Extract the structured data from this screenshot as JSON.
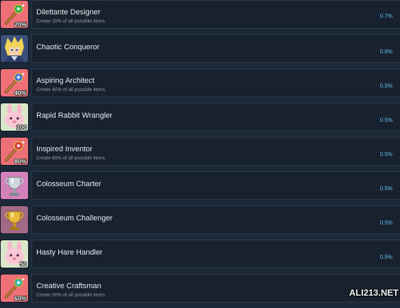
{
  "achievements": [
    {
      "title": "Dilettante Designer",
      "description": "Create 20% of all possible items.",
      "percent": "0.7%",
      "icon": "wand-icon",
      "badge": "20%"
    },
    {
      "title": "Chaotic Conqueror",
      "description": "",
      "percent": "0.6%",
      "icon": "hero-portrait-icon",
      "badge": ""
    },
    {
      "title": "Aspiring Architect",
      "description": "Create 40% of all possible items.",
      "percent": "0.5%",
      "icon": "wand-icon",
      "badge": "40%"
    },
    {
      "title": "Rapid Rabbit Wrangler",
      "description": "",
      "percent": "0.5%",
      "icon": "pink-rabbit-icon",
      "badge": "100"
    },
    {
      "title": "Inspired Inventor",
      "description": "Create 80% of all possible items.",
      "percent": "0.5%",
      "icon": "wand-icon",
      "badge": "80%"
    },
    {
      "title": "Colosseum Charter",
      "description": "",
      "percent": "0.5%",
      "icon": "silver-trophy-icon",
      "badge": ""
    },
    {
      "title": "Colosseum Challenger",
      "description": "",
      "percent": "0.5%",
      "icon": "gold-trophy-icon",
      "badge": ""
    },
    {
      "title": "Hasty Hare Handler",
      "description": "",
      "percent": "0.5%",
      "icon": "pink-rabbit-icon",
      "badge": "50"
    },
    {
      "title": "Creative Craftsman",
      "description": "Create 60% of all possible items.",
      "percent": "",
      "icon": "wand-icon",
      "badge": "60%"
    }
  ],
  "watermark": "ALI213.NET",
  "colors": {
    "background": "#1b2838",
    "percent": "#66c0f4"
  }
}
